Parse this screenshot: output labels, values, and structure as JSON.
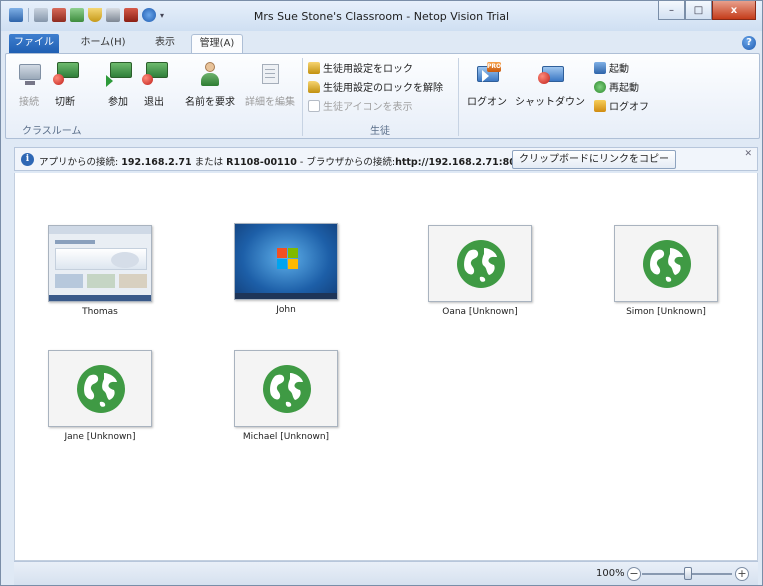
{
  "window": {
    "title": "Mrs Sue Stone's Classroom - Netop Vision Trial",
    "minimize_label": "–",
    "maximize_label": "□",
    "close_label": "x"
  },
  "tabs": [
    {
      "label": "ファイル"
    },
    {
      "label": "ホーム(H)"
    },
    {
      "label": "表示"
    },
    {
      "label": "管理(A)"
    }
  ],
  "help_label": "?",
  "ribbon": {
    "connect_label": "接続",
    "disconnect_label": "切断",
    "join_label": "参加",
    "leave_label": "退出",
    "request_name_label": "名前を要求",
    "edit_details_label": "詳細を編集",
    "classroom_group_label": "クラスルーム",
    "lock_settings_label": "生徒用設定をロック",
    "unlock_settings_label": "生徒用設定のロックを解除",
    "show_icon_label": "生徒アイコンを表示",
    "students_group_label": "生徒",
    "logon_label": "ログオン",
    "shutdown_label": "シャットダウン",
    "start_label": "起動",
    "restart_label": "再起動",
    "logoff_label": "ログオフ"
  },
  "infobar": {
    "prefix": "アプリからの接続:",
    "ip": "192.168.2.71",
    "or": "または",
    "host": "R1108-00110",
    "browser_prefix": "- ブラウザからの接続:",
    "url": "http://192.168.2.71:80",
    "copy_button": "クリップボードにリンクをコピー",
    "close_label": "✕"
  },
  "students": [
    {
      "name": "Thomas",
      "screen": "browser"
    },
    {
      "name": "John",
      "screen": "windows7"
    },
    {
      "name": "Oana [Unknown]",
      "screen": "globe"
    },
    {
      "name": "Simon [Unknown]",
      "screen": "globe"
    },
    {
      "name": "Jane [Unknown]",
      "screen": "globe"
    },
    {
      "name": "Michael [Unknown]",
      "screen": "globe"
    }
  ],
  "statusbar": {
    "zoom": "100%",
    "zoom_out_label": "−",
    "zoom_in_label": "+"
  },
  "colors": {
    "accent": "#1f5fb3",
    "globe_green": "#3f9a44"
  }
}
